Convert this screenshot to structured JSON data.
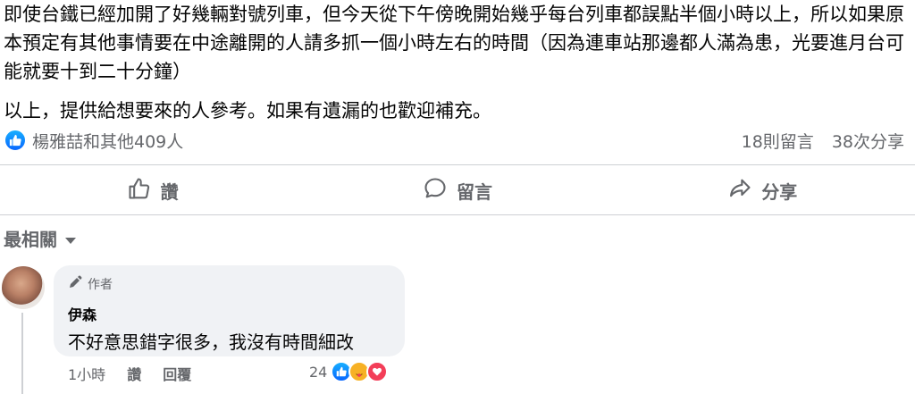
{
  "post": {
    "paragraph_1": "即使台鐵已經加開了好幾輛對號列車，但今天從下午傍晚開始幾乎每台列車都誤點半個小時以上，所以如果原本預定有其他事情要在中途離開的人請多抓一個小時左右的時間（因為連車站那邊都人滿為患，光要進月台可能就要十到二十分鐘）",
    "paragraph_2": "以上，提供給想要來的人參考。如果有遺漏的也歡迎補充。"
  },
  "stats": {
    "reactors": "楊雅喆和其他409人",
    "comments": "18則留言",
    "shares": "38次分享"
  },
  "actions": {
    "like": "讚",
    "comment": "留言",
    "share": "分享"
  },
  "sort": {
    "label": "最相關"
  },
  "comment": {
    "author_badge": "作者",
    "name": "伊森",
    "text": "不好意思錯字很多，我沒有時間細改",
    "time": "1小時",
    "like": "讚",
    "reply": "回覆",
    "reaction_count": "24"
  },
  "colors": {
    "facebook_blue": "#0866ff",
    "secondary_text": "#65676b",
    "bubble_bg": "#f0f2f5"
  }
}
